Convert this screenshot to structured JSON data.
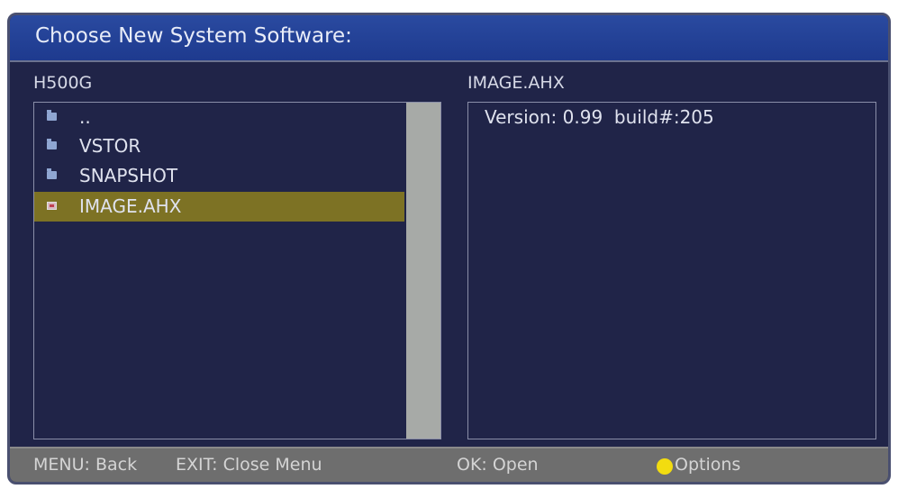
{
  "title": "Choose New System Software:",
  "left_panel": {
    "label": "H500G",
    "items": [
      {
        "label": "..",
        "icon": "folder-icon"
      },
      {
        "label": "VSTOR",
        "icon": "folder-icon"
      },
      {
        "label": "SNAPSHOT",
        "icon": "folder-icon"
      },
      {
        "label": "IMAGE.AHX",
        "icon": "image-file-icon",
        "selected": true
      }
    ]
  },
  "right_panel": {
    "label": "IMAGE.AHX",
    "info": "Version: 0.99  build#:205"
  },
  "footer": {
    "menu": "MENU: Back",
    "exit": "EXIT: Close Menu",
    "ok": "OK: Open",
    "options": "Options",
    "options_color": "#f2dc10"
  },
  "colors": {
    "background": "#202448",
    "titlebar": "#1e3a8e",
    "selected_row": "#7d7224",
    "footer": "#6e6e6e"
  }
}
